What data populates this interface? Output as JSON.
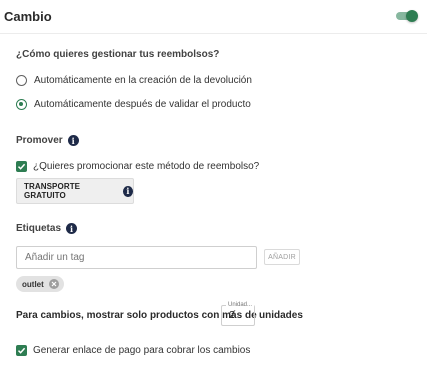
{
  "header": {
    "title": "Cambio",
    "toggle_on": true
  },
  "refund": {
    "question": "¿Cómo quieres gestionar tus reembolsos?",
    "options": [
      {
        "label": "Automáticamente en la creación de la devolución",
        "checked": false
      },
      {
        "label": "Automáticamente después de validar el producto",
        "checked": true
      }
    ]
  },
  "promover": {
    "label": "Promover",
    "checkbox_label": "¿Quieres promocionar este método de reembolso?",
    "checked": true,
    "chip_label": "TRANSPORTE GRATUITO"
  },
  "etiquetas": {
    "label": "Etiquetas",
    "input_placeholder": "Añadir un tag",
    "input_value": "",
    "add_button": "AÑADIR",
    "tags": [
      "outlet"
    ]
  },
  "units": {
    "prefix": "Para cambios, mostrar solo productos con más de",
    "field_label": "Unidad...",
    "value": "2",
    "suffix": "unidades"
  },
  "payment_link": {
    "label": "Generar enlace de pago para cobrar los cambios",
    "checked": true
  },
  "colors": {
    "accent": "#2e7d52",
    "info_icon": "#1e2a48"
  },
  "icons": {
    "info": "info-icon",
    "check": "check-icon",
    "close": "close-icon"
  }
}
